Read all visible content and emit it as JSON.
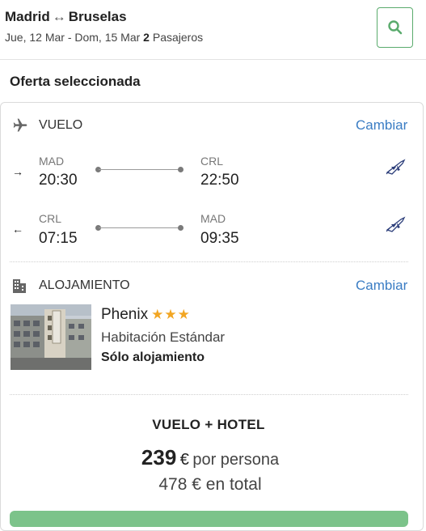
{
  "search": {
    "origin": "Madrid",
    "route_arrow": "↔",
    "destination": "Bruselas",
    "dates": "Jue, 12 Mar - Dom, 15 Mar",
    "passengers_count": "2",
    "passengers_label": "Pasajeros",
    "search_icon": "search-icon"
  },
  "offer": {
    "title": "Oferta seleccionada"
  },
  "flight": {
    "section_label": "VUELO",
    "change_label": "Cambiar",
    "icon": "plane-icon",
    "outbound": {
      "direction": "→",
      "from_code": "MAD",
      "from_time": "20:30",
      "to_code": "CRL",
      "to_time": "22:50",
      "airline_icon": "airline-logo-icon"
    },
    "return": {
      "direction": "←",
      "from_code": "CRL",
      "from_time": "07:15",
      "to_code": "MAD",
      "to_time": "09:35",
      "airline_icon": "airline-logo-icon"
    }
  },
  "accommodation": {
    "section_label": "ALOJAMIENTO",
    "change_label": "Cambiar",
    "icon": "building-icon",
    "hotel_name": "Phenix",
    "stars": "★★★",
    "room_type": "Habitación Estándar",
    "board": "Sólo alojamiento"
  },
  "package": {
    "title": "VUELO + HOTEL",
    "price_per_person": "239",
    "currency": "€",
    "per_person_label": "por persona",
    "price_total": "478",
    "total_label": "en total"
  },
  "colors": {
    "accent_green": "#5aab6d",
    "link_blue": "#3b7dc4",
    "star_gold": "#f2a623",
    "cta_green": "#7cc38a"
  }
}
